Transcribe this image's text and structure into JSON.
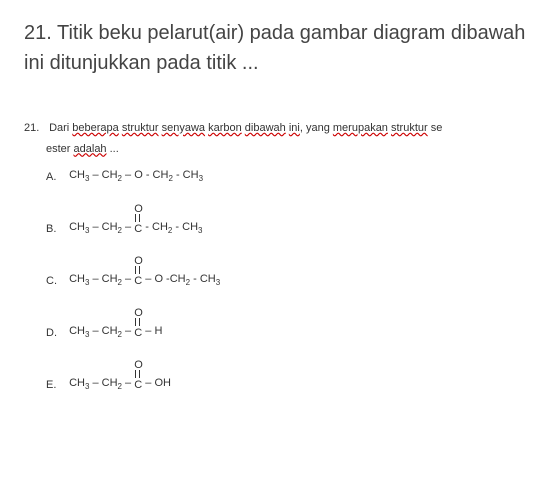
{
  "main_question": {
    "number": "21.",
    "text": "Titik beku pelarut(air) pada gambar diagram dibawah ini ditunjukkan pada titik ..."
  },
  "sub_question": {
    "number": "21.",
    "prefix": "Dari ",
    "wavy1": "beberapa",
    "mid1": " ",
    "wavy2": "struktur",
    "mid2": " ",
    "wavy3": "senyawa",
    "mid3": " ",
    "wavy4": "karbon",
    "mid4": " ",
    "wavy5": "dibawah",
    "mid5": " ",
    "wavy6": "ini",
    "mid6": ", yang ",
    "wavy7": "merupakan",
    "mid7": " ",
    "wavy8": "struktur",
    "mid8": " se",
    "line2_prefix": "ester ",
    "line2_wavy": "adalah",
    "line2_suffix": " ..."
  },
  "options": {
    "a": {
      "letter": "A.",
      "p1": "CH",
      "p2": " – CH",
      "p3": " – O - CH",
      "p4": " - CH"
    },
    "b": {
      "letter": "B.",
      "p1": "CH",
      "p2": " – CH",
      "p3": " – ",
      "p4": " - CH",
      "p5": " - CH"
    },
    "c": {
      "letter": "C.",
      "p1": "CH",
      "p2": " – CH",
      "p3": " – ",
      "p4": " – O -CH",
      "p5": " - CH"
    },
    "d": {
      "letter": "D.",
      "p1": "CH",
      "p2": " – CH",
      "p3": " – ",
      "p4": " – H"
    },
    "e": {
      "letter": "E.",
      "p1": "CH",
      "p2": " – CH",
      "p3": " – ",
      "p4": " – OH"
    }
  }
}
